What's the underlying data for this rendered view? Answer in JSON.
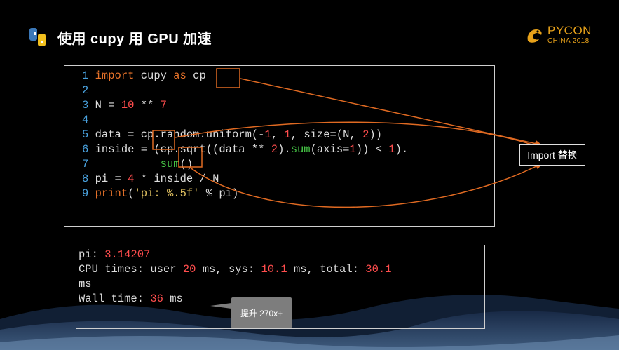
{
  "title": "使用 cupy 用 GPU 加速",
  "logo": {
    "line1": "PYCON",
    "line2": "CHINA 2018"
  },
  "code": {
    "line_numbers": [
      "1",
      "2",
      "3",
      "4",
      "5",
      "6",
      "7",
      "8",
      "9"
    ],
    "l1": {
      "kw1": "import",
      "mod": " cupy ",
      "kw2": "as",
      "alias": "cp"
    },
    "l3": {
      "a": "N = ",
      "n1": "10",
      "b": " ** ",
      "n2": "7"
    },
    "l5": {
      "a": "data = ",
      "cp": "cp",
      "b": ".random.uniform(-",
      "n1": "1",
      "c": ", ",
      "n2": "1",
      "d": ", size=(N, ",
      "n3": "2",
      "e": "))"
    },
    "l6": {
      "a": "inside = (",
      "cp": "cp",
      "b": ".sqrt((data ** ",
      "n1": "2",
      "c": ").",
      "f1": "sum",
      "d": "(axis=",
      "n2": "1",
      "e": ")) < ",
      "n3": "1",
      "g": ")."
    },
    "l7": {
      "indent": "          ",
      "f": "sum",
      "r": "()"
    },
    "l8": {
      "a": "pi = ",
      "n1": "4",
      "b": " * inside / N"
    },
    "l9": {
      "f": "print",
      "a": "(",
      "s": "'pi: %.5f'",
      "b": " % pi)"
    }
  },
  "output": {
    "l1": {
      "a": "pi: ",
      "v": "3.14207"
    },
    "l2": {
      "a": "CPU times: user ",
      "v1": "20",
      "b": " ms, sys: ",
      "v2": "10.1",
      "c": " ms, total: ",
      "v3": "30.1"
    },
    "l3": "ms",
    "l4": {
      "a": "Wall time: ",
      "v": "36",
      "b": " ms"
    }
  },
  "callout": "Import 替换",
  "tooltip": "提升 270x+",
  "colors": {
    "accent": "#E06A22",
    "logo": "#E8A21A",
    "code_number": "#FF4D4D",
    "code_keyword": "#E8732A",
    "line_number": "#4AA3E0",
    "function": "#47C847"
  }
}
